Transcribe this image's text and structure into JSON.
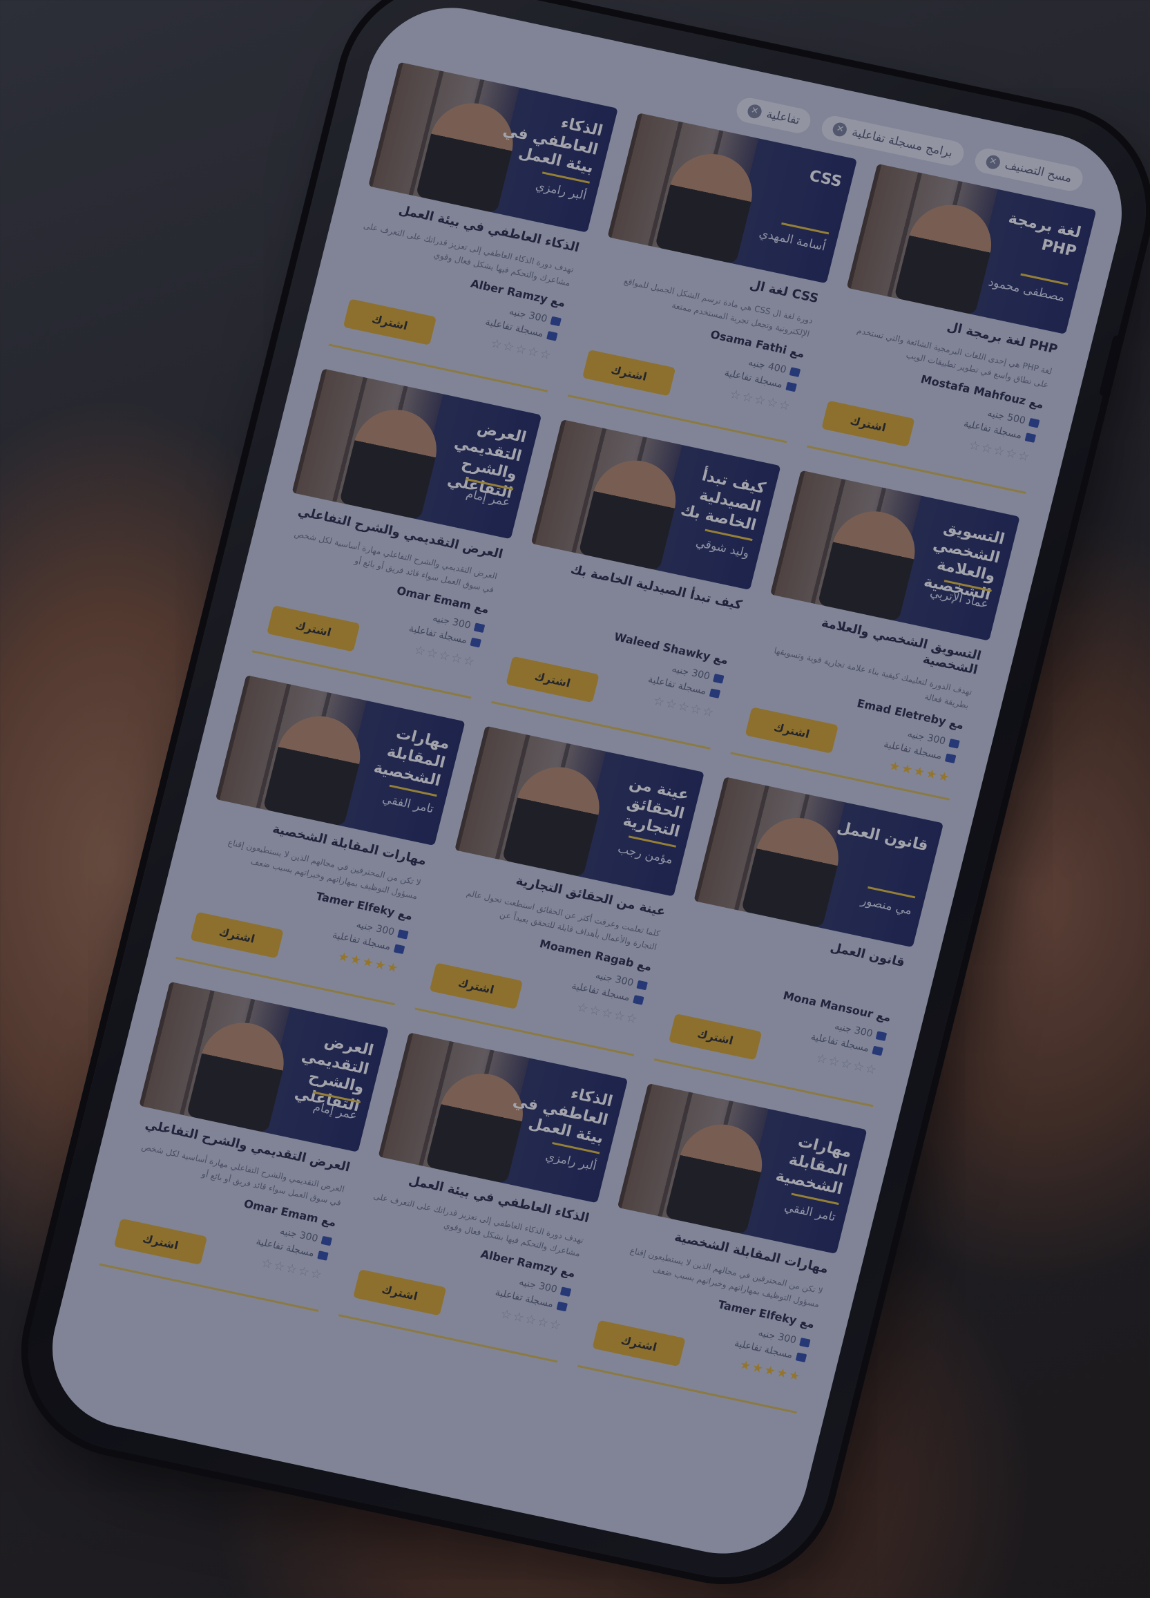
{
  "filters": [
    {
      "label": "مسح التصنيف",
      "close_glyph": "✕"
    },
    {
      "label": "برامج مسجلة تفاعلية",
      "close_glyph": "✕"
    },
    {
      "label": "تفاعلية",
      "close_glyph": "✕"
    }
  ],
  "by_prefix": "مع",
  "subscribe_label": "اشترك",
  "format_label": "مسجلة تفاعلية",
  "courses": [
    {
      "thumb_title": "لغة برمجة PHP",
      "thumb_instructor": "مصطفى محمود",
      "title": "PHP لغة برمجة ال",
      "desc": "لغة PHP هي إحدى اللغات البرمجية الشائعة والتي تستخدم على نطاق واسع في تطوير تطبيقات الويب",
      "instructor": "Mostafa Mahfouz",
      "price": "500 جنيه",
      "stars": "☆☆☆☆☆",
      "rated": false
    },
    {
      "thumb_title": "CSS",
      "thumb_instructor": "أسامة المهدي",
      "title": "CSS لغة ال",
      "desc": "دورة لغة ال CSS هي مادة ترسم الشكل الجميل للمواقع الإلكترونية وتجعل تجربة المستخدم ممتعة",
      "instructor": "Osama Fathi",
      "price": "400 جنيه",
      "stars": "☆☆☆☆☆",
      "rated": false
    },
    {
      "thumb_title": "الذكاء العاطفي في بيئة العمل",
      "thumb_instructor": "ألبر رامزي",
      "title": "الذكاء العاطفي في بيئة العمل",
      "desc": "تهدف دورة الذكاء العاطفي إلى تعزيز قدراتك على التعرف على مشاعرك والتحكم فيها بشكل فعال وقوي",
      "instructor": "Alber Ramzy",
      "price": "300 جنيه",
      "stars": "☆☆☆☆☆",
      "rated": false
    },
    {
      "thumb_title": "التسويق الشخصي والعلامة الشخصية",
      "thumb_instructor": "عماد الإتربي",
      "title": "التسويق الشخصي والعلامة الشخصية",
      "desc": "تهدف الدورة لتعليمك كيفية بناء علامة تجارية قوية وتسويقها بطريقة فعالة",
      "instructor": "Emad Eletreby",
      "price": "300 جنيه",
      "stars": "★★★★★",
      "rated": true
    },
    {
      "thumb_title": "كيف تبدأ الصيدلية الخاصة بك",
      "thumb_instructor": "وليد شوقي",
      "title": "كيف تبدأ الصيدلية الخاصة بك",
      "desc": "",
      "instructor": "Waleed Shawky",
      "price": "300 جنيه",
      "stars": "☆☆☆☆☆",
      "rated": false
    },
    {
      "thumb_title": "العرض التقديمي والشرح التفاعلي",
      "thumb_instructor": "عمر إمام",
      "title": "العرض التقديمي والشرح التفاعلي",
      "desc": "العرض التقديمي والشرح التفاعلي مهارة أساسية لكل شخص في سوق العمل سواء قائد فريق أو بائع أو",
      "instructor": "Omar Emam",
      "price": "300 جنيه",
      "stars": "☆☆☆☆☆",
      "rated": false
    },
    {
      "thumb_title": "قانون العمل",
      "thumb_instructor": "مي منصور",
      "title": "قانون العمل",
      "desc": "",
      "instructor": "Mona Mansour",
      "price": "300 جنيه",
      "stars": "☆☆☆☆☆",
      "rated": false
    },
    {
      "thumb_title": "عينة من الحقائق التجارية",
      "thumb_instructor": "مؤمن رجب",
      "title": "عينة من الحقائق التجارية",
      "desc": "كلما تعلمت وعرفت أكثر عن الحقائق استطعت تحول عالم التجارة والأعمال بأهداف قابلة للتحقق بعيداً عن",
      "instructor": "Moamen Ragab",
      "price": "300 جنيه",
      "stars": "☆☆☆☆☆",
      "rated": false
    },
    {
      "thumb_title": "مهارات المقابلة الشخصية",
      "thumb_instructor": "تامر الفقي",
      "title": "مهارات المقابلة الشخصية",
      "desc": "لا تكن من المحترفين في مجالهم الذين لا يستطيعون إقناع مسؤول التوظيف بمهاراتهم وخبراتهم بسبب ضعف",
      "instructor": "Tamer Elfeky",
      "price": "300 جنيه",
      "stars": "★★★★★",
      "rated": true
    },
    {
      "thumb_title": "مهارات المقابلة الشخصية",
      "thumb_instructor": "تامر الفقي",
      "title": "مهارات المقابلة الشخصية",
      "desc": "لا تكن من المحترفين في مجالهم الذين لا يستطيعون إقناع مسؤول التوظيف بمهاراتهم وخبراتهم بسبب ضعف",
      "instructor": "Tamer Elfeky",
      "price": "300 جنيه",
      "stars": "★★★★★",
      "rated": true
    },
    {
      "thumb_title": "الذكاء العاطفي في بيئة العمل",
      "thumb_instructor": "ألبر رامزي",
      "title": "الذكاء العاطفي في بيئة العمل",
      "desc": "تهدف دورة الذكاء العاطفي إلى تعزيز قدراتك على التعرف على مشاعرك والتحكم فيها بشكل فعال وقوي",
      "instructor": "Alber Ramzy",
      "price": "300 جنيه",
      "stars": "☆☆☆☆☆",
      "rated": false
    },
    {
      "thumb_title": "العرض التقديمي والشرح التفاعلي",
      "thumb_instructor": "عمر إمام",
      "title": "العرض التقديمي والشرح التفاعلي",
      "desc": "العرض التقديمي والشرح التفاعلي مهارة أساسية لكل شخص في سوق العمل سواء قائد فريق أو بائع أو",
      "instructor": "Omar Emam",
      "price": "300 جنيه",
      "stars": "☆☆☆☆☆",
      "rated": false
    }
  ]
}
